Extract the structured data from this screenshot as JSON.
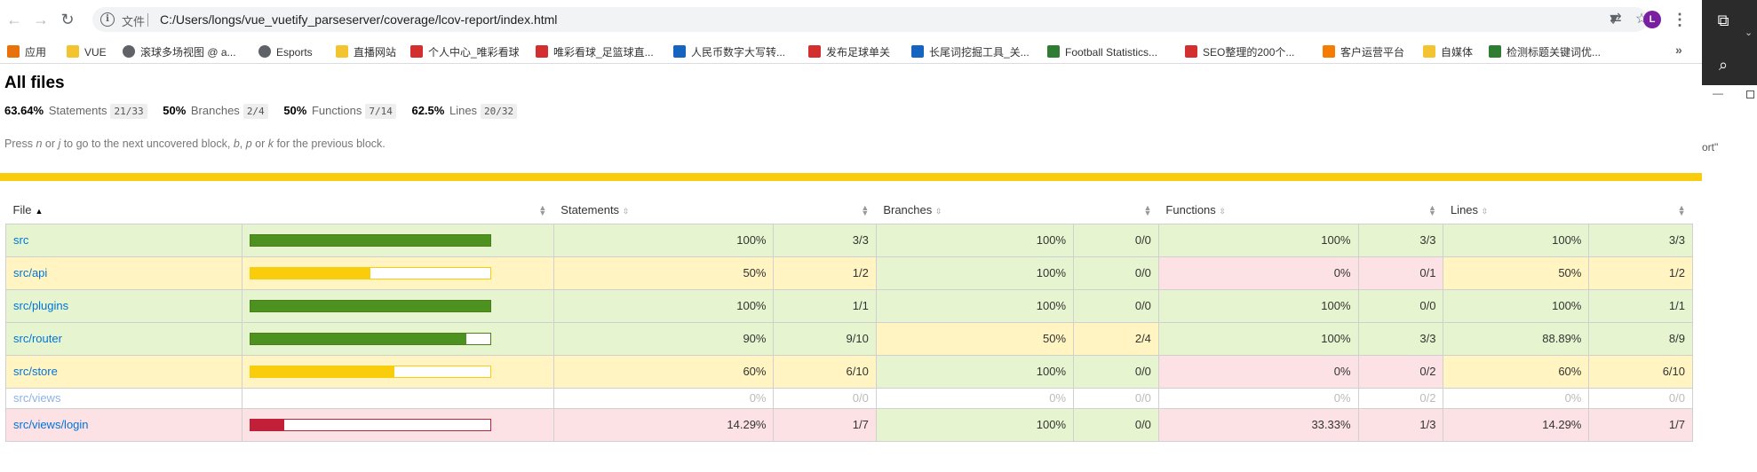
{
  "browser": {
    "scheme_label": "文件",
    "url": "C:/Users/longs/vue_vuetify_parseserver/coverage/lcov-report/index.html",
    "avatar_initial": "L",
    "more_glyph": "»"
  },
  "bookmarks": [
    {
      "label": "应用",
      "icon": "apps-grid-icon"
    },
    {
      "label": "VUE",
      "icon": "folder-icon"
    },
    {
      "label": "滚球多场视图 @ a...",
      "icon": "globe-icon"
    },
    {
      "label": "Esports",
      "icon": "globe-icon"
    },
    {
      "label": "直播网站",
      "icon": "folder-icon"
    },
    {
      "label": "个人中心_唯彩看球",
      "icon": "site-icon"
    },
    {
      "label": "唯彩看球_足篮球直...",
      "icon": "site-icon"
    },
    {
      "label": "人民币数字大写转...",
      "icon": "site-icon"
    },
    {
      "label": "发布足球单关",
      "icon": "site-icon"
    },
    {
      "label": "长尾词挖掘工具_关...",
      "icon": "site-icon"
    },
    {
      "label": "Football Statistics...",
      "icon": "site-icon"
    },
    {
      "label": "SEO整理的200个...",
      "icon": "site-icon"
    },
    {
      "label": "客户运营平台",
      "icon": "site-icon"
    },
    {
      "label": "自媒体",
      "icon": "folder-icon"
    },
    {
      "label": "检测标题关键词优...",
      "icon": "site-icon"
    }
  ],
  "side_panel": {
    "minus": "—",
    "fragment": "ort\""
  },
  "report": {
    "title": "All files",
    "summary": [
      {
        "pct": "63.64%",
        "label": "Statements",
        "frac": "21/33"
      },
      {
        "pct": "50%",
        "label": "Branches",
        "frac": "2/4"
      },
      {
        "pct": "50%",
        "label": "Functions",
        "frac": "7/14"
      },
      {
        "pct": "62.5%",
        "label": "Lines",
        "frac": "20/32"
      }
    ],
    "hint": {
      "t1": "Press ",
      "k1": "n",
      "t2": " or ",
      "k2": "j",
      "t3": " to go to the next uncovered block, ",
      "k3": "b",
      "t4": ", ",
      "k4": "p",
      "t5": " or ",
      "k5": "k",
      "t6": " for the previous block."
    },
    "columns": {
      "file": "File",
      "statements": "Statements",
      "branches": "Branches",
      "functions": "Functions",
      "lines": "Lines"
    },
    "rows": [
      {
        "file": "src",
        "level": "high",
        "coverage": 1.0,
        "stmt_pct": "100%",
        "stmt_frac": "3/3",
        "stmt_lvl": "high",
        "br_pct": "100%",
        "br_frac": "0/0",
        "br_lvl": "high",
        "fn_pct": "100%",
        "fn_frac": "3/3",
        "fn_lvl": "high",
        "ln_pct": "100%",
        "ln_frac": "3/3",
        "ln_lvl": "high"
      },
      {
        "file": "src/api",
        "level": "med",
        "coverage": 0.5,
        "stmt_pct": "50%",
        "stmt_frac": "1/2",
        "stmt_lvl": "med",
        "br_pct": "100%",
        "br_frac": "0/0",
        "br_lvl": "high",
        "fn_pct": "0%",
        "fn_frac": "0/1",
        "fn_lvl": "low",
        "ln_pct": "50%",
        "ln_frac": "1/2",
        "ln_lvl": "med"
      },
      {
        "file": "src/plugins",
        "level": "high",
        "coverage": 1.0,
        "stmt_pct": "100%",
        "stmt_frac": "1/1",
        "stmt_lvl": "high",
        "br_pct": "100%",
        "br_frac": "0/0",
        "br_lvl": "high",
        "fn_pct": "100%",
        "fn_frac": "0/0",
        "fn_lvl": "high",
        "ln_pct": "100%",
        "ln_frac": "1/1",
        "ln_lvl": "high"
      },
      {
        "file": "src/router",
        "level": "high",
        "coverage": 0.9,
        "stmt_pct": "90%",
        "stmt_frac": "9/10",
        "stmt_lvl": "high",
        "br_pct": "50%",
        "br_frac": "2/4",
        "br_lvl": "med",
        "fn_pct": "100%",
        "fn_frac": "3/3",
        "fn_lvl": "high",
        "ln_pct": "88.89%",
        "ln_frac": "8/9",
        "ln_lvl": "high"
      },
      {
        "file": "src/store",
        "level": "med",
        "coverage": 0.6,
        "stmt_pct": "60%",
        "stmt_frac": "6/10",
        "stmt_lvl": "med",
        "br_pct": "100%",
        "br_frac": "0/0",
        "br_lvl": "high",
        "fn_pct": "0%",
        "fn_frac": "0/2",
        "fn_lvl": "low",
        "ln_pct": "60%",
        "ln_frac": "6/10",
        "ln_lvl": "med"
      },
      {
        "file": "src/views",
        "level": "empty",
        "coverage": null,
        "stmt_pct": "0%",
        "stmt_frac": "0/0",
        "stmt_lvl": "empty",
        "br_pct": "0%",
        "br_frac": "0/0",
        "br_lvl": "empty",
        "fn_pct": "0%",
        "fn_frac": "0/2",
        "fn_lvl": "empty",
        "ln_pct": "0%",
        "ln_frac": "0/0",
        "ln_lvl": "empty"
      },
      {
        "file": "src/views/login",
        "level": "low",
        "coverage": 0.1429,
        "stmt_pct": "14.29%",
        "stmt_frac": "1/7",
        "stmt_lvl": "low",
        "br_pct": "100%",
        "br_frac": "0/0",
        "br_lvl": "high",
        "fn_pct": "33.33%",
        "fn_frac": "1/3",
        "fn_lvl": "low",
        "ln_pct": "14.29%",
        "ln_frac": "1/7",
        "ln_lvl": "low"
      }
    ]
  },
  "colors": {
    "high_bg": "#e6f5d0",
    "medium_bg": "#fff4c2",
    "low_bg": "#fce1e5",
    "high_bar": "#4d9221",
    "medium_bar": "#f9cd0b",
    "low_bar": "#c21f39",
    "status_strip": "#f9cd0b",
    "link": "#0074d9"
  }
}
